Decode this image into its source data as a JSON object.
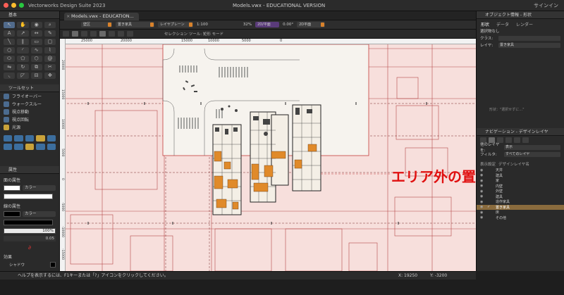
{
  "app": {
    "name": "Vectorworks Design Suite 2023",
    "document_title": "Models.vwx - EDUCATIONAL VERSION",
    "user": "サインイン"
  },
  "colors": {
    "window_close": "#ff5f57",
    "window_min": "#febc2e",
    "window_max": "#28c840",
    "active_layer": "#8a6b3d",
    "annotation": "#e01010",
    "canvas_bg": "#f7dfdc"
  },
  "tab": {
    "label": "Models.vwx - EDUCATION..."
  },
  "toolbar1": {
    "class_drop": "壁区",
    "layer_drop": "置き家具",
    "plane_drop": "レイヤプレーン",
    "scale": "1:100",
    "zoom": "32%",
    "view_drop": "2D/平面",
    "angle": "0.00°",
    "view2_drop": "2D平面"
  },
  "toolbar2": {
    "mode_text": "セレクション ツール: 矩形 モード"
  },
  "left_panels": {
    "basic": {
      "title": "基本"
    },
    "toolset": {
      "title": "ツールセット",
      "items": [
        "フライオーバー",
        "ウォークスルー",
        "視点移動",
        "視点回転",
        "光源"
      ]
    },
    "attributes": {
      "title": "属性",
      "fill_label": "面の属性",
      "fill_style": "カラー",
      "line_label": "線の属性",
      "line_style": "カラー",
      "opacity": "100%",
      "thickness": "0.05",
      "effects_label": "効果",
      "shadow_label": "シャドウ"
    }
  },
  "ruler": {
    "top": [
      "25000",
      "20000",
      "15000",
      "10000",
      "5000",
      "0"
    ],
    "left": [
      "20000",
      "15000",
      "10000",
      "5000",
      "0",
      "-5000",
      "-10000",
      "-15000"
    ]
  },
  "annotation": {
    "text": "エリア外の置き家具"
  },
  "status": {
    "hint": "ヘルプを表示するには、F1キーまたは「?」アイコンをクリックしてください。",
    "x": "X: 19250",
    "y": "Y: -3200"
  },
  "right_panels": {
    "obj_info": {
      "title": "オブジェクト情報 - 形状",
      "tabs": [
        "形状",
        "データ",
        "レンダー"
      ],
      "selection": "選択物なし",
      "class_label": "クラス:",
      "layer_label": "レイヤ:",
      "layer_value": "置き家具",
      "placeholder": "形状：\"選択せずに…\""
    },
    "navigation": {
      "title": "ナビゲーション - デザインレイヤ",
      "other_layers_label": "他のレイヤを:",
      "other_layers_value": "表示",
      "filter_label": "フィルタ:",
      "filter_value": "すべてのレイヤ",
      "header_visibility": "表示設定",
      "header_name": "デザインレイヤ名",
      "layers": [
        {
          "name": "天井",
          "active": false
        },
        {
          "name": "建具",
          "active": false
        },
        {
          "name": "家",
          "active": false
        },
        {
          "name": "内壁",
          "active": false
        },
        {
          "name": "外壁",
          "active": false
        },
        {
          "name": "建具",
          "active": false
        },
        {
          "name": "造作家具",
          "active": false
        },
        {
          "name": "置き家具",
          "active": true
        },
        {
          "name": "床",
          "active": false
        },
        {
          "name": "その他",
          "active": false
        }
      ]
    }
  }
}
